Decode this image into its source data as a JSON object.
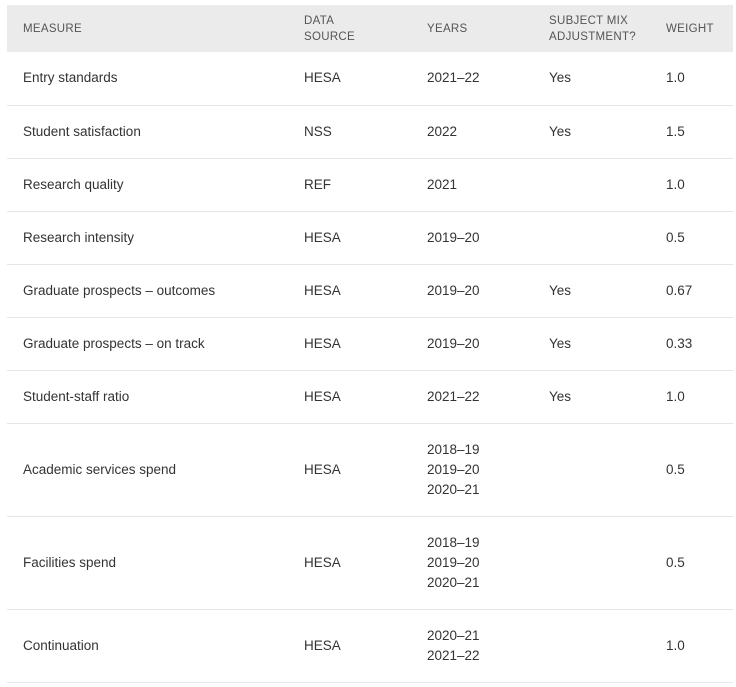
{
  "table": {
    "headers": {
      "measure": "MEASURE",
      "data_source": [
        "DATA",
        "SOURCE"
      ],
      "years": "YEARS",
      "subject_mix": [
        "SUBJECT MIX",
        "ADJUSTMENT?"
      ],
      "weight": "WEIGHT"
    },
    "rows": [
      {
        "measure": "Entry standards",
        "source": "HESA",
        "years": [
          "2021–22"
        ],
        "adjustment": "Yes",
        "weight": "1.0"
      },
      {
        "measure": "Student satisfaction",
        "source": "NSS",
        "years": [
          "2022"
        ],
        "adjustment": "Yes",
        "weight": "1.5"
      },
      {
        "measure": "Research quality",
        "source": "REF",
        "years": [
          "2021"
        ],
        "adjustment": "",
        "weight": "1.0"
      },
      {
        "measure": "Research intensity",
        "source": "HESA",
        "years": [
          "2019–20"
        ],
        "adjustment": "",
        "weight": "0.5"
      },
      {
        "measure": "Graduate prospects – outcomes",
        "source": "HESA",
        "years": [
          "2019–20"
        ],
        "adjustment": "Yes",
        "weight": "0.67"
      },
      {
        "measure": "Graduate prospects – on track",
        "source": "HESA",
        "years": [
          "2019–20"
        ],
        "adjustment": "Yes",
        "weight": "0.33"
      },
      {
        "measure": "Student-staff ratio",
        "source": "HESA",
        "years": [
          "2021–22"
        ],
        "adjustment": "Yes",
        "weight": "1.0"
      },
      {
        "measure": "Academic services spend",
        "source": "HESA",
        "years": [
          "2018–19",
          "2019–20",
          "2020–21"
        ],
        "adjustment": "",
        "weight": "0.5"
      },
      {
        "measure": "Facilities spend",
        "source": "HESA",
        "years": [
          "2018–19",
          "2019–20",
          "2020–21"
        ],
        "adjustment": "",
        "weight": "0.5"
      },
      {
        "measure": "Continuation",
        "source": "HESA",
        "years": [
          "2020–21",
          "2021–22"
        ],
        "adjustment": "",
        "weight": "1.0"
      }
    ]
  }
}
